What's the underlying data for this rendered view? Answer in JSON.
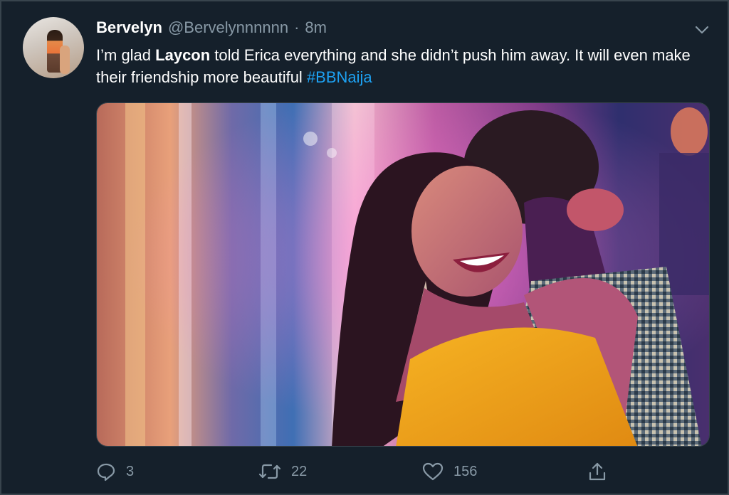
{
  "tweet": {
    "display_name": "Bervelyn",
    "handle": "@Bervelynnnnnn",
    "separator": "·",
    "time": "8m",
    "text_part1": "I’m glad ",
    "text_bold": "Laycon",
    "text_part2": " told Erica everything and she didn’t push him away. It will even make their friendship more beautiful ",
    "hashtag": "#BBNaija"
  },
  "actions": {
    "reply_count": "3",
    "retweet_count": "22",
    "like_count": "156"
  },
  "icons": {
    "caret": "chevron-down-icon",
    "reply": "reply-icon",
    "retweet": "retweet-icon",
    "like": "heart-icon",
    "share": "share-icon"
  },
  "colors": {
    "background": "#15202b",
    "secondary_text": "#8899a6",
    "accent": "#1da1f2"
  }
}
